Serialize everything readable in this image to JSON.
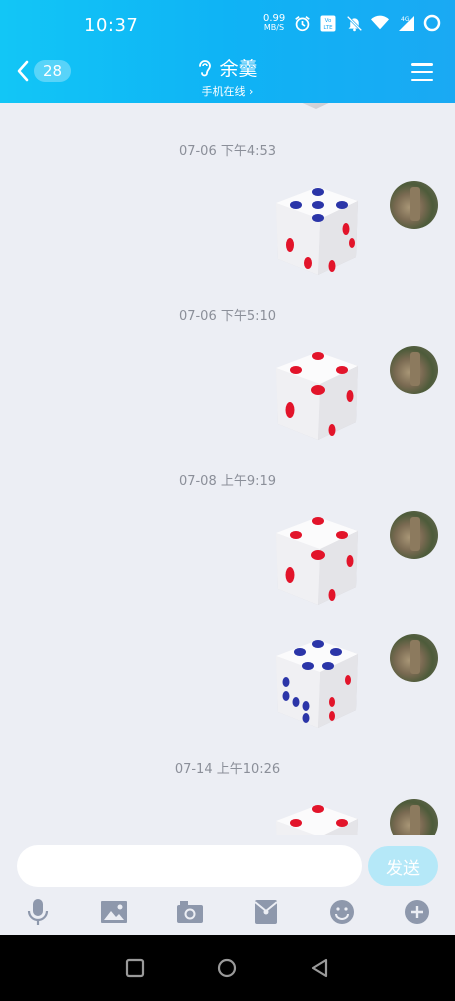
{
  "status": {
    "time": "10:37",
    "net_speed_value": "0.99",
    "net_speed_unit": "MB/S",
    "icons": [
      "alarm-icon",
      "volte-icon",
      "mute-icon",
      "wifi-icon",
      "signal-4g-icon",
      "battery-ring-icon"
    ]
  },
  "header": {
    "back_count": "28",
    "contact_name": "余羹",
    "contact_status": "手机在线 ›"
  },
  "messages": {
    "timestamps": [
      "07-06 下午4:53",
      "07-06 下午5:10",
      "07-08 上午9:19",
      "07-14 上午10:26"
    ],
    "dice": [
      {
        "value": 4,
        "color": "blue"
      },
      {
        "value": 3,
        "color": "red"
      },
      {
        "value": 3,
        "color": "red"
      },
      {
        "value": 5,
        "color": "blue"
      },
      {
        "value": 2,
        "color": "red"
      }
    ]
  },
  "input": {
    "placeholder": "",
    "send_label": "发送"
  },
  "toolbar": [
    "mic-icon",
    "image-icon",
    "camera-icon",
    "red-packet-icon",
    "emoji-icon",
    "plus-icon"
  ],
  "colors": {
    "header_gradient_start": "#12c6f6",
    "header_gradient_end": "#1aa9f3",
    "background": "#eceef4",
    "send_button": "#b5e8f8",
    "dice_blue": "#2b35a8",
    "dice_red": "#e2142a",
    "toolbar_icon": "#8e98ac"
  }
}
